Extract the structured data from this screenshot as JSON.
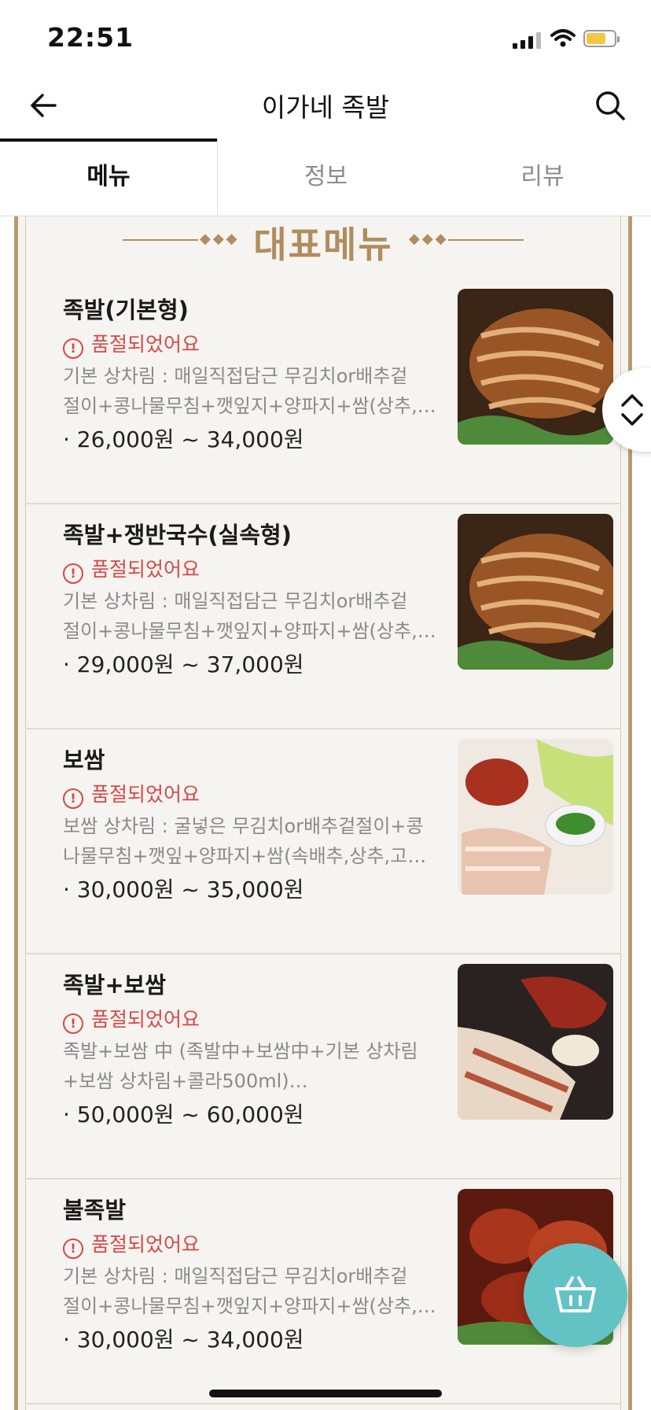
{
  "status_bar": {
    "time": "22:51"
  },
  "header": {
    "title": "이가네 족발"
  },
  "tabs": [
    {
      "label": "메뉴",
      "active": true
    },
    {
      "label": "정보",
      "active": false
    },
    {
      "label": "리뷰",
      "active": false
    }
  ],
  "banner": {
    "title": "대표메뉴"
  },
  "menu_items": [
    {
      "name": "족발(기본형)",
      "status": "품절되었어요",
      "desc_line1": "기본 상차림 : 매일직접담근 무김치or배추겉",
      "desc_line2": "절이+콩나물무침+깻잎지+양파지+쌈(상추,…",
      "price": "· 26,000원 ~ 34,000원"
    },
    {
      "name": "족발+쟁반국수(실속형)",
      "status": "품절되었어요",
      "desc_line1": "기본 상차림 : 매일직접담근 무김치or배추겉",
      "desc_line2": "절이+콩나물무침+깻잎지+양파지+쌈(상추,…",
      "price": "· 29,000원 ~ 37,000원"
    },
    {
      "name": "보쌈",
      "status": "품절되었어요",
      "desc_line1": "보쌈 상차림 : 굴넣은 무김치or배추겉절이+콩",
      "desc_line2": "나물무침+깻잎+양파지+쌈(속배추,상추,고…",
      "price": "· 30,000원 ~ 35,000원"
    },
    {
      "name": "족발+보쌈",
      "status": "품절되었어요",
      "desc_line1": "족발+보쌈 中 (족발中+보쌈中+기본 상차림",
      "desc_line2": "+보쌈 상차림+콜라500ml)…",
      "price": "· 50,000원 ~ 60,000원"
    },
    {
      "name": "불족발",
      "status": "품절되었어요",
      "desc_line1": "기본 상차림 : 매일직접담근 무김치or배추겉",
      "desc_line2": "절이+콩나물무침+깻잎지+양파지+쌈(상추,…",
      "price": "· 30,000원 ~ 34,000원"
    }
  ],
  "icons": {
    "back": "arrow-left-icon",
    "search": "search-icon",
    "scroll": "chevron-up-down-icon",
    "cart": "basket-icon",
    "soldout": "exclamation-circle-icon"
  },
  "colors": {
    "accent_gold": "#b08c5e",
    "soldout_red": "#d7484a",
    "cart_teal": "#63c3c4"
  }
}
